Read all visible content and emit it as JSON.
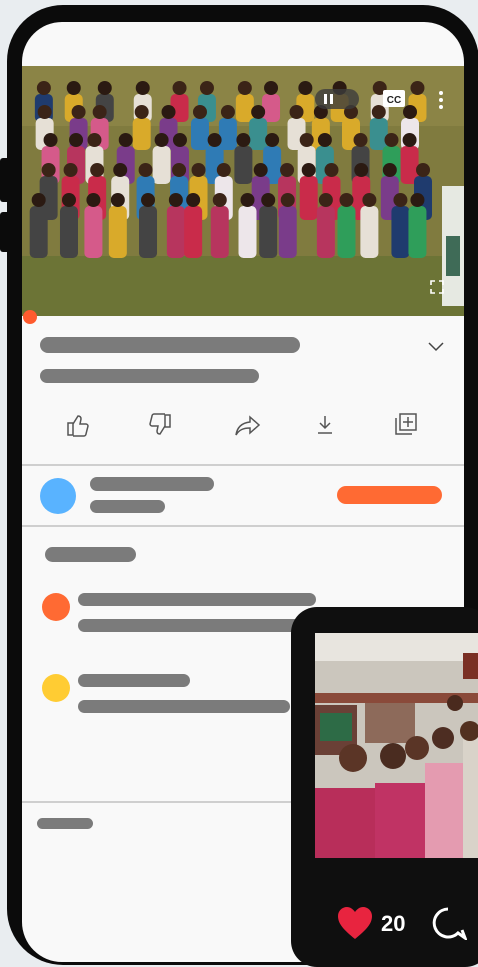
{
  "colors": {
    "orange": "#ff6a33",
    "blue": "#59b3ff",
    "yellow": "#ffcc33",
    "gray_bar": "#7b7b7b",
    "progress": "#ff5b2e",
    "heart": "#e8243f"
  },
  "video": {
    "cc_label": "CC",
    "progress": 0
  },
  "actions": [
    {
      "icon": "thumbs-up-icon"
    },
    {
      "icon": "thumbs-down-icon"
    },
    {
      "icon": "share-icon"
    },
    {
      "icon": "download-icon"
    },
    {
      "icon": "save-to-playlist-icon"
    }
  ],
  "reel": {
    "like_count": "20"
  }
}
